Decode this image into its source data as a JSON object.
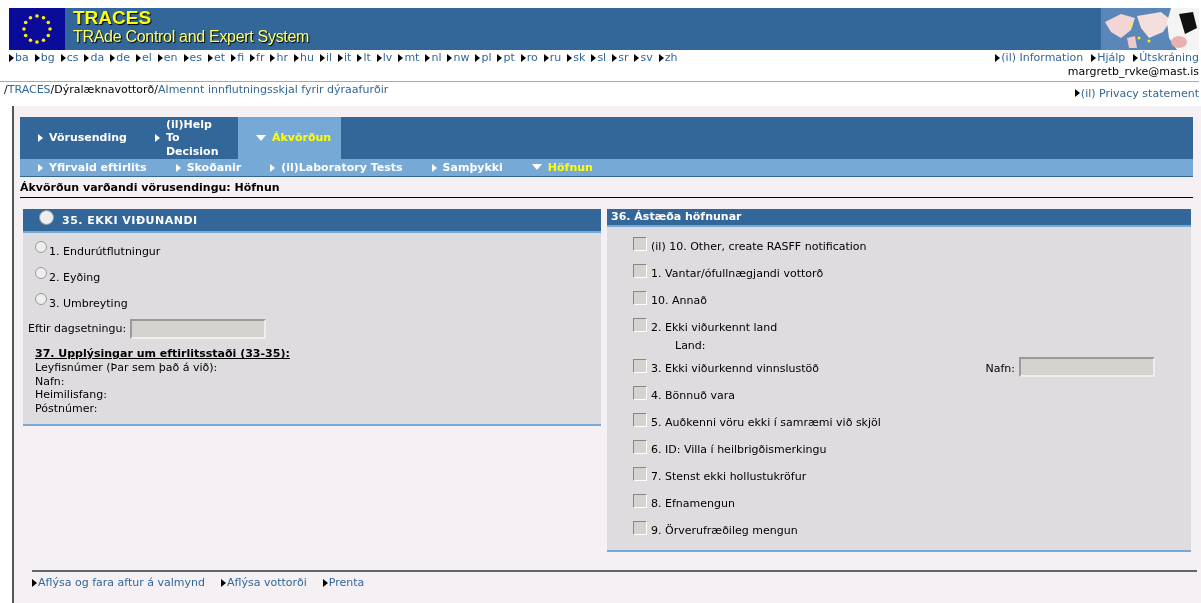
{
  "header": {
    "title": "TRACES",
    "subtitle": "TRAde Control and Expert System"
  },
  "languages": [
    "ba",
    "bg",
    "cs",
    "da",
    "de",
    "el",
    "en",
    "es",
    "et",
    "fi",
    "fr",
    "hr",
    "hu",
    "il",
    "it",
    "lt",
    "lv",
    "mt",
    "nl",
    "nw",
    "pl",
    "pt",
    "ro",
    "ru",
    "sk",
    "sl",
    "sr",
    "sv",
    "zh"
  ],
  "user_links": [
    "(il) Information",
    "Hjálp",
    "Útskráning"
  ],
  "user_email": "margretb_rvke@mast.is",
  "breadcrumb": [
    {
      "text": "/",
      "kind": "separator"
    },
    {
      "text": "TRACES",
      "kind": "link"
    },
    {
      "text": "/",
      "kind": "separator"
    },
    {
      "text": "Dýralæknavottorð",
      "kind": "text"
    },
    {
      "text": "/",
      "kind": "separator"
    },
    {
      "text": "Almennt innflutningsskjal fyrir dýraafurðir",
      "kind": "link"
    }
  ],
  "privacy_link": "(il) Privacy statement",
  "tabs": [
    {
      "label": "Vörusending",
      "selected": false
    },
    {
      "label": "(il)Help To Decision",
      "selected": false
    },
    {
      "label": "Ákvörðun",
      "selected": true
    }
  ],
  "subtabs": [
    {
      "label": "Yfirvald eftirlits",
      "selected": false
    },
    {
      "label": "Skoðanir",
      "selected": false
    },
    {
      "label": "(il)Laboratory Tests",
      "selected": false
    },
    {
      "label": "Samþykki",
      "selected": false
    },
    {
      "label": "Höfnun",
      "selected": true
    }
  ],
  "page_title": "Ákvörðun varðandi vörusendingu: Höfnun",
  "left_panel": {
    "title": "35. EKKI VIÐUNANDI",
    "selected": false,
    "options": [
      {
        "label": "1. Endurútflutningur",
        "selected": false
      },
      {
        "label": "2. Eyðing",
        "selected": false
      },
      {
        "label": "3. Umbreyting",
        "selected": false
      }
    ],
    "date_label": "Eftir dagsetningu:",
    "info_title": "37. Upplýsingar um eftirlitsstaði (33-35):",
    "info_lines": [
      "Leyfisnúmer (Þar sem það á við):",
      "Nafn:",
      "Heimilisfang:",
      "Póstnúmer:"
    ]
  },
  "right_panel": {
    "title": "36. Ástæða höfnunar",
    "reasons": [
      {
        "label": "(il) 10. Other, create RASFF notification",
        "checked": false
      },
      {
        "label": "1. Vantar/ófullnægjandi vottorð",
        "checked": false
      },
      {
        "label": "10. Annað",
        "checked": false
      },
      {
        "label": "2. Ekki viðurkennt land",
        "checked": false,
        "sub_label": "Land:"
      },
      {
        "label": "3. Ekki viðurkennd vinnslustöð",
        "checked": false,
        "field_label": "Nafn:"
      },
      {
        "label": "4. Bönnuð vara",
        "checked": false
      },
      {
        "label": "5. Auðkenni vöru ekki í samræmi við skjöl",
        "checked": false
      },
      {
        "label": "6. ID: Villa í heilbrigðismerkingu",
        "checked": false
      },
      {
        "label": "7. Stenst ekki hollustukröfur",
        "checked": false
      },
      {
        "label": "8. Efnamengun",
        "checked": false
      },
      {
        "label": "9. Örverufræðileg mengun",
        "checked": false
      }
    ]
  },
  "footer_links": [
    "Aflýsa og fara aftur á valmynd",
    "Aflýsa vottorði",
    "Prenta"
  ]
}
